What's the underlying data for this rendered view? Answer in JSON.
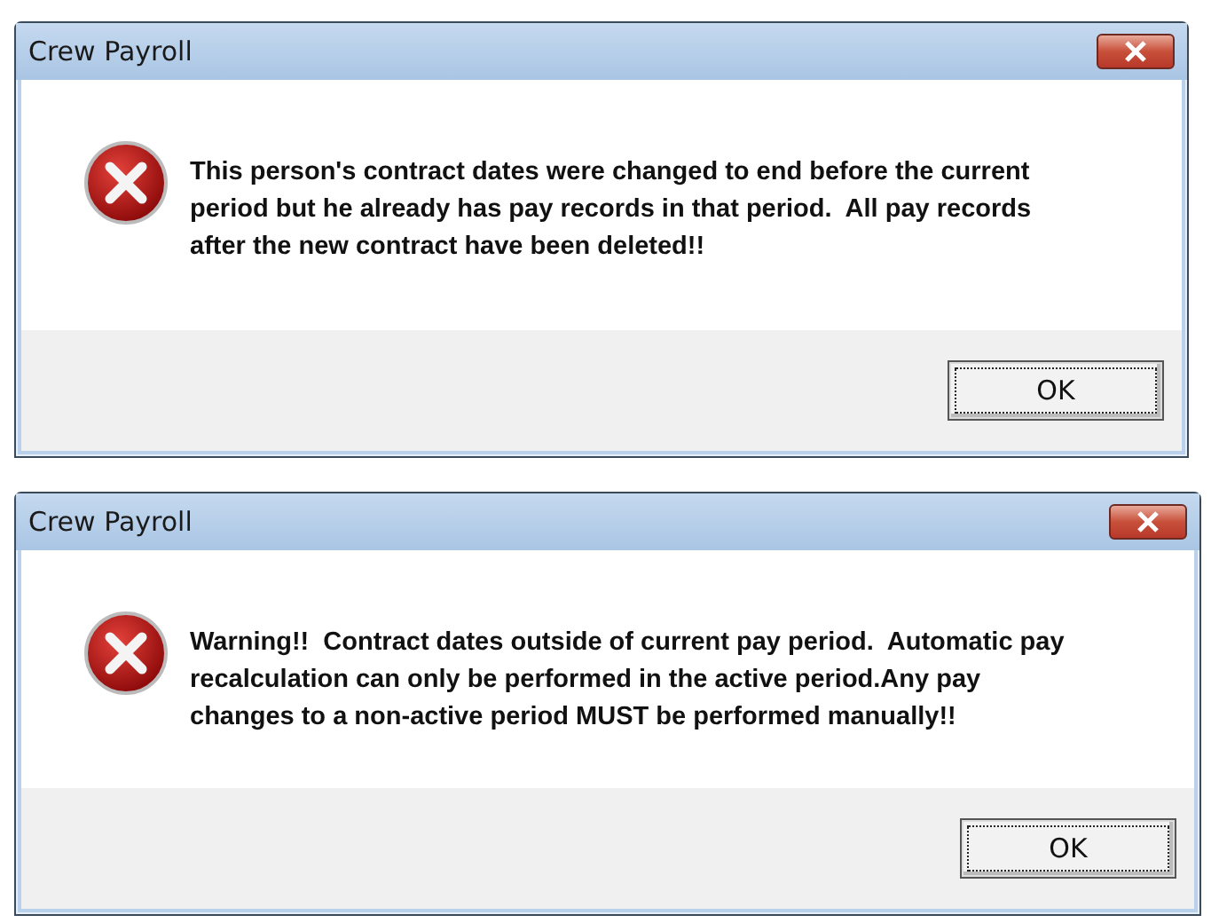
{
  "dialogs": [
    {
      "title": "Crew Payroll",
      "message": "This person's contract dates were changed to end before the current\nperiod but he already has pay records in that period.  All pay records\nafter the new contract have been deleted!!",
      "buttons": [
        {
          "label": "OK",
          "focused": true
        }
      ]
    },
    {
      "title": "Crew Payroll",
      "message": "Warning!!  Contract dates outside of current pay period.  Automatic pay\nrecalculation can only be performed in the active period.Any pay\nchanges to a non-active period MUST be performed manually!!",
      "buttons": [
        {
          "label": "OK",
          "focused": true
        }
      ]
    }
  ]
}
